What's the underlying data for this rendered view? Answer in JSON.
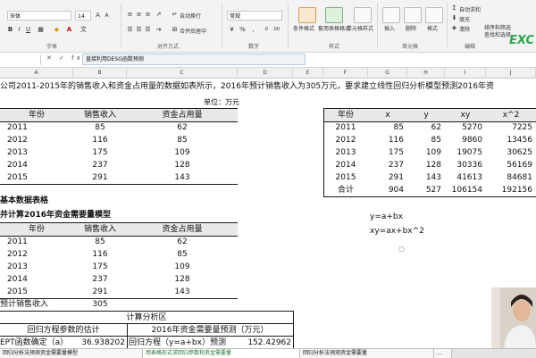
{
  "ribbon": {
    "font_name": "宋体",
    "font_size": "14",
    "number_format": "常规",
    "wrap_text": "自动换行",
    "merge_center": "合并后居中",
    "autosum": "自动求和",
    "fill": "填充",
    "clear": "清除",
    "sort_filter": "排序和筛选",
    "find_select": "查找和选择",
    "cond_format": "条件格式",
    "table_format": "套用表格格式",
    "cell_style": "单元格样式",
    "insert": "插入",
    "delete": "删除",
    "format": "格式",
    "groups": {
      "font": "字体",
      "alignment": "对齐方式",
      "number": "数字",
      "styles": "样式",
      "cells": "单元格",
      "editing": "编辑"
    },
    "logo": "EXC"
  },
  "formula_bar": {
    "fx": "✕ ✓ fx",
    "content": "直接利用DESG函数预测"
  },
  "columns": [
    "A",
    "B",
    "C",
    "D",
    "E",
    "F",
    "G",
    "H",
    "I",
    "J"
  ],
  "sheet": {
    "title": "公司2011-2015年的销售收入和资金占用量的数据如表所示，2016年预计销售收入为305万元，要求建立线性回归分析模型预测2016年资",
    "unit": "单位：万元",
    "table1": {
      "headers": [
        "年份",
        "销售收入",
        "资金占用量"
      ],
      "rows": [
        [
          "2011",
          "85",
          "62"
        ],
        [
          "2012",
          "116",
          "85"
        ],
        [
          "2013",
          "175",
          "109"
        ],
        [
          "2014",
          "237",
          "128"
        ],
        [
          "2015",
          "291",
          "143"
        ]
      ]
    },
    "table2": {
      "headers": [
        "年份",
        "x",
        "y",
        "xy",
        "x^2"
      ],
      "rows": [
        [
          "2011",
          "85",
          "62",
          "5270",
          "7225"
        ],
        [
          "2012",
          "116",
          "85",
          "9860",
          "13456"
        ],
        [
          "2013",
          "175",
          "109",
          "19075",
          "30625"
        ],
        [
          "2014",
          "237",
          "128",
          "30336",
          "56169"
        ],
        [
          "2015",
          "291",
          "143",
          "41613",
          "84681"
        ],
        [
          "合计",
          "904",
          "527",
          "106154",
          "192156"
        ]
      ]
    },
    "formula1": "y=a+bx",
    "formula2": "xy=ax+bx^2",
    "basic_data_label": "基本数据表格",
    "model_label": "并计算2016年资金需要量模型",
    "table3": {
      "headers": [
        "年份",
        "销售收入",
        "资金占用量"
      ],
      "rows": [
        [
          "2011",
          "85",
          "62"
        ],
        [
          "2012",
          "116",
          "85"
        ],
        [
          "2013",
          "175",
          "109"
        ],
        [
          "2014",
          "237",
          "128"
        ],
        [
          "2015",
          "291",
          "143"
        ]
      ]
    },
    "forecast_label": "预计销售收入",
    "forecast_value": "305",
    "calc_area": "计算分析区",
    "reg_params": "回归方程参数的估计",
    "forecast_2016": "2016年资金需要量预测（万元）",
    "intercept_label": "EPT函数确定（a）",
    "intercept_value": "36.938202",
    "reg_eq_label": "回归方程（y=a+bx）预测",
    "reg_eq_value": "152.42962"
  },
  "tabs": [
    "回归分析法预测资金需要量模型",
    "用表格形式求回归参数和资金需要量",
    "回归分析法预测资金需要量",
    "…"
  ]
}
